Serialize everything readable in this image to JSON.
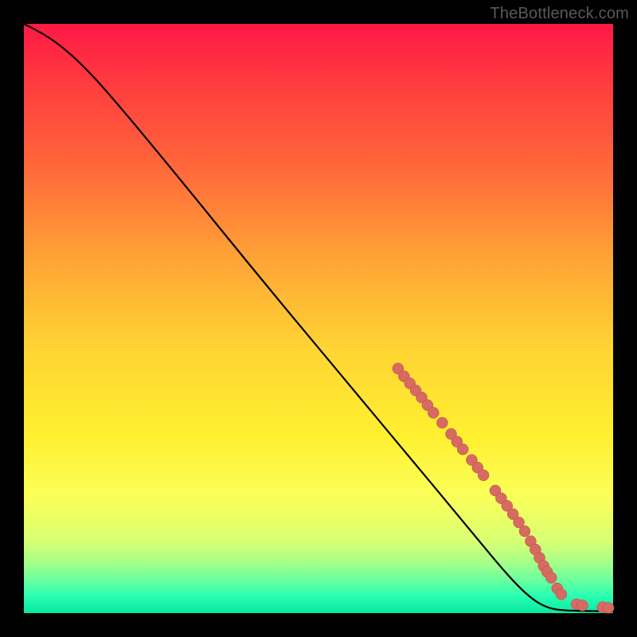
{
  "watermark": "TheBottleneck.com",
  "colors": {
    "dot_fill": "#d76a62",
    "dot_stroke": "#b24f47",
    "curve": "#000000",
    "frame": "#000000"
  },
  "chart_data": {
    "type": "line",
    "title": "",
    "xlabel": "",
    "ylabel": "",
    "xlim": [
      0,
      100
    ],
    "ylim": [
      0,
      100
    ],
    "grid": false,
    "legend": false,
    "curve_points": [
      {
        "x": 0,
        "y": 100
      },
      {
        "x": 3,
        "y": 98.5
      },
      {
        "x": 6,
        "y": 96.5
      },
      {
        "x": 10,
        "y": 93
      },
      {
        "x": 15,
        "y": 87.5
      },
      {
        "x": 25,
        "y": 75.5
      },
      {
        "x": 40,
        "y": 57
      },
      {
        "x": 55,
        "y": 39
      },
      {
        "x": 65,
        "y": 27
      },
      {
        "x": 75,
        "y": 15
      },
      {
        "x": 82,
        "y": 6.5
      },
      {
        "x": 86,
        "y": 2.5
      },
      {
        "x": 89,
        "y": 0.8
      },
      {
        "x": 92,
        "y": 0.4
      },
      {
        "x": 100,
        "y": 0.3
      }
    ],
    "scatter_points": [
      {
        "x": 63.5,
        "y": 41.5
      },
      {
        "x": 64.5,
        "y": 40.2
      },
      {
        "x": 65.5,
        "y": 39.0
      },
      {
        "x": 66.5,
        "y": 37.8
      },
      {
        "x": 67.5,
        "y": 36.6
      },
      {
        "x": 68.5,
        "y": 35.3
      },
      {
        "x": 69.5,
        "y": 34.0
      },
      {
        "x": 71.0,
        "y": 32.3
      },
      {
        "x": 72.5,
        "y": 30.4
      },
      {
        "x": 73.5,
        "y": 29.1
      },
      {
        "x": 74.5,
        "y": 27.8
      },
      {
        "x": 76.0,
        "y": 26.0
      },
      {
        "x": 77.0,
        "y": 24.7
      },
      {
        "x": 78.0,
        "y": 23.4
      },
      {
        "x": 80.0,
        "y": 20.8
      },
      {
        "x": 81.0,
        "y": 19.5
      },
      {
        "x": 82.0,
        "y": 18.2
      },
      {
        "x": 83.0,
        "y": 16.8
      },
      {
        "x": 84.0,
        "y": 15.4
      },
      {
        "x": 85.0,
        "y": 13.9
      },
      {
        "x": 86.0,
        "y": 12.2
      },
      {
        "x": 86.8,
        "y": 10.8
      },
      {
        "x": 87.5,
        "y": 9.4
      },
      {
        "x": 88.2,
        "y": 8.0
      },
      {
        "x": 88.8,
        "y": 7.0
      },
      {
        "x": 89.5,
        "y": 6.0
      },
      {
        "x": 90.5,
        "y": 4.2
      },
      {
        "x": 91.2,
        "y": 3.2
      },
      {
        "x": 93.8,
        "y": 1.5
      },
      {
        "x": 94.8,
        "y": 1.3
      },
      {
        "x": 98.2,
        "y": 1.0
      },
      {
        "x": 99.2,
        "y": 0.9
      }
    ],
    "dot_radius_px": 7
  }
}
